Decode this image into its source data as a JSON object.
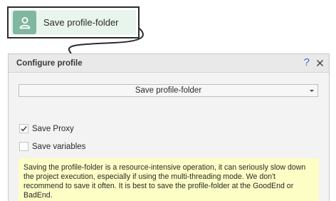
{
  "action_node": {
    "icon": "user-profile-icon",
    "label": "Save profile-folder"
  },
  "dialog": {
    "title": "Configure profile",
    "help_label": "?",
    "close_icon": "close-icon",
    "action_select": {
      "selected": "Save profile-folder"
    },
    "options": [
      {
        "label": "Save Proxy",
        "checked": true
      },
      {
        "label": "Save variables",
        "checked": false
      }
    ],
    "note": "Saving the profile-folder is a resource-intensive operation, it can seriously slow down the project execution, especially if using the multi-threading mode. We don't recommend to save it often. It is best to save the profile-folder at the GoodEnd or BadEnd."
  },
  "colors": {
    "node_fill": "#e8f5ec",
    "node_icon": "#7fb7a0",
    "note_bg": "#fdfdc6",
    "help_blue": "#3b6fd6"
  }
}
